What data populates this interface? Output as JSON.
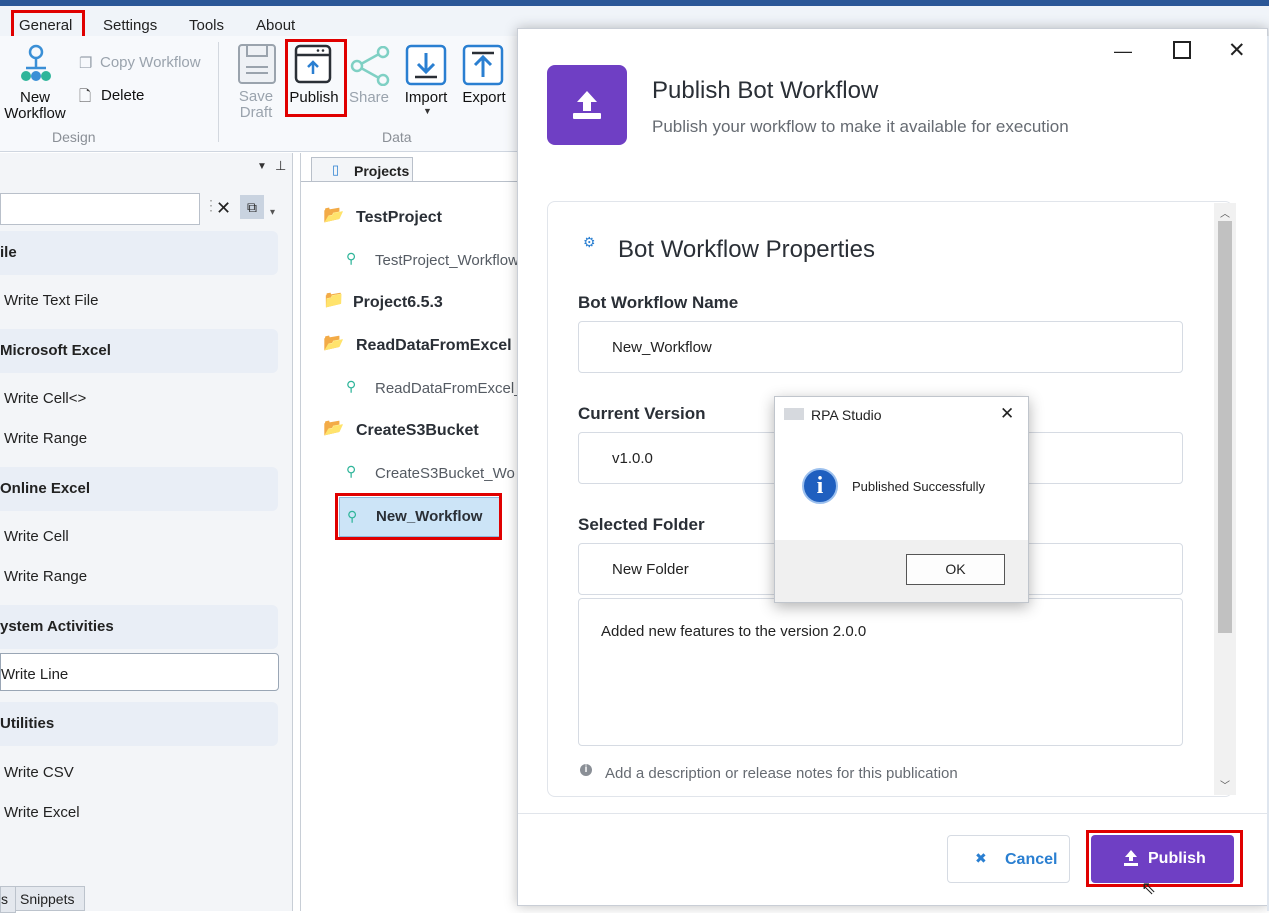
{
  "menu": {
    "tabs": [
      "General",
      "Settings",
      "Tools",
      "About"
    ]
  },
  "ribbon": {
    "new_workflow": "New\nWorkflow",
    "copy_workflow": "Copy Workflow",
    "delete": "Delete",
    "design_group": "Design",
    "save_draft": "Save\nDraft",
    "publish": "Publish",
    "share": "Share",
    "import": "Import",
    "export": "Export",
    "data_group": "Data"
  },
  "activities": {
    "categories": [
      {
        "name": "ile",
        "items": [
          "Write Text File"
        ]
      },
      {
        "name": "Microsoft Excel",
        "items": [
          "Write Cell<>",
          "Write Range"
        ]
      },
      {
        "name": "Online Excel",
        "items": [
          "Write Cell",
          "Write Range"
        ]
      },
      {
        "name": "ystem Activities",
        "items": [
          "Write Line"
        ]
      },
      {
        "name": "Utilities",
        "items": [
          "Write CSV",
          "Write Excel"
        ]
      }
    ],
    "bottom_tabs": [
      "s",
      "Snippets"
    ]
  },
  "projects": {
    "tab": "Projects",
    "items": [
      "TestProject",
      "TestProject_Workflow",
      "Project6.5.3",
      "ReadDataFromExcel",
      "ReadDataFromExcel_",
      "CreateS3Bucket",
      "CreateS3Bucket_Wo",
      "New_Workflow"
    ]
  },
  "dialog": {
    "title": "Publish Bot Workflow",
    "subtitle": "Publish your workflow to make it available for execution",
    "section_title": "Bot Workflow Properties",
    "name_label": "Bot Workflow Name",
    "name_value": "New_Workflow",
    "version_label": "Current Version",
    "version_value": "v1.0.0",
    "folder_label": "Selected Folder",
    "folder_value": "New Folder",
    "notes_value": "Added new features to the version 2.0.0",
    "hint": "Add a description or release notes for this publication",
    "cancel": "Cancel",
    "publish": "Publish",
    "accent": "#6f3fc4"
  },
  "messagebox": {
    "title": "RPA Studio",
    "message": "Published Successfully",
    "ok": "OK"
  }
}
